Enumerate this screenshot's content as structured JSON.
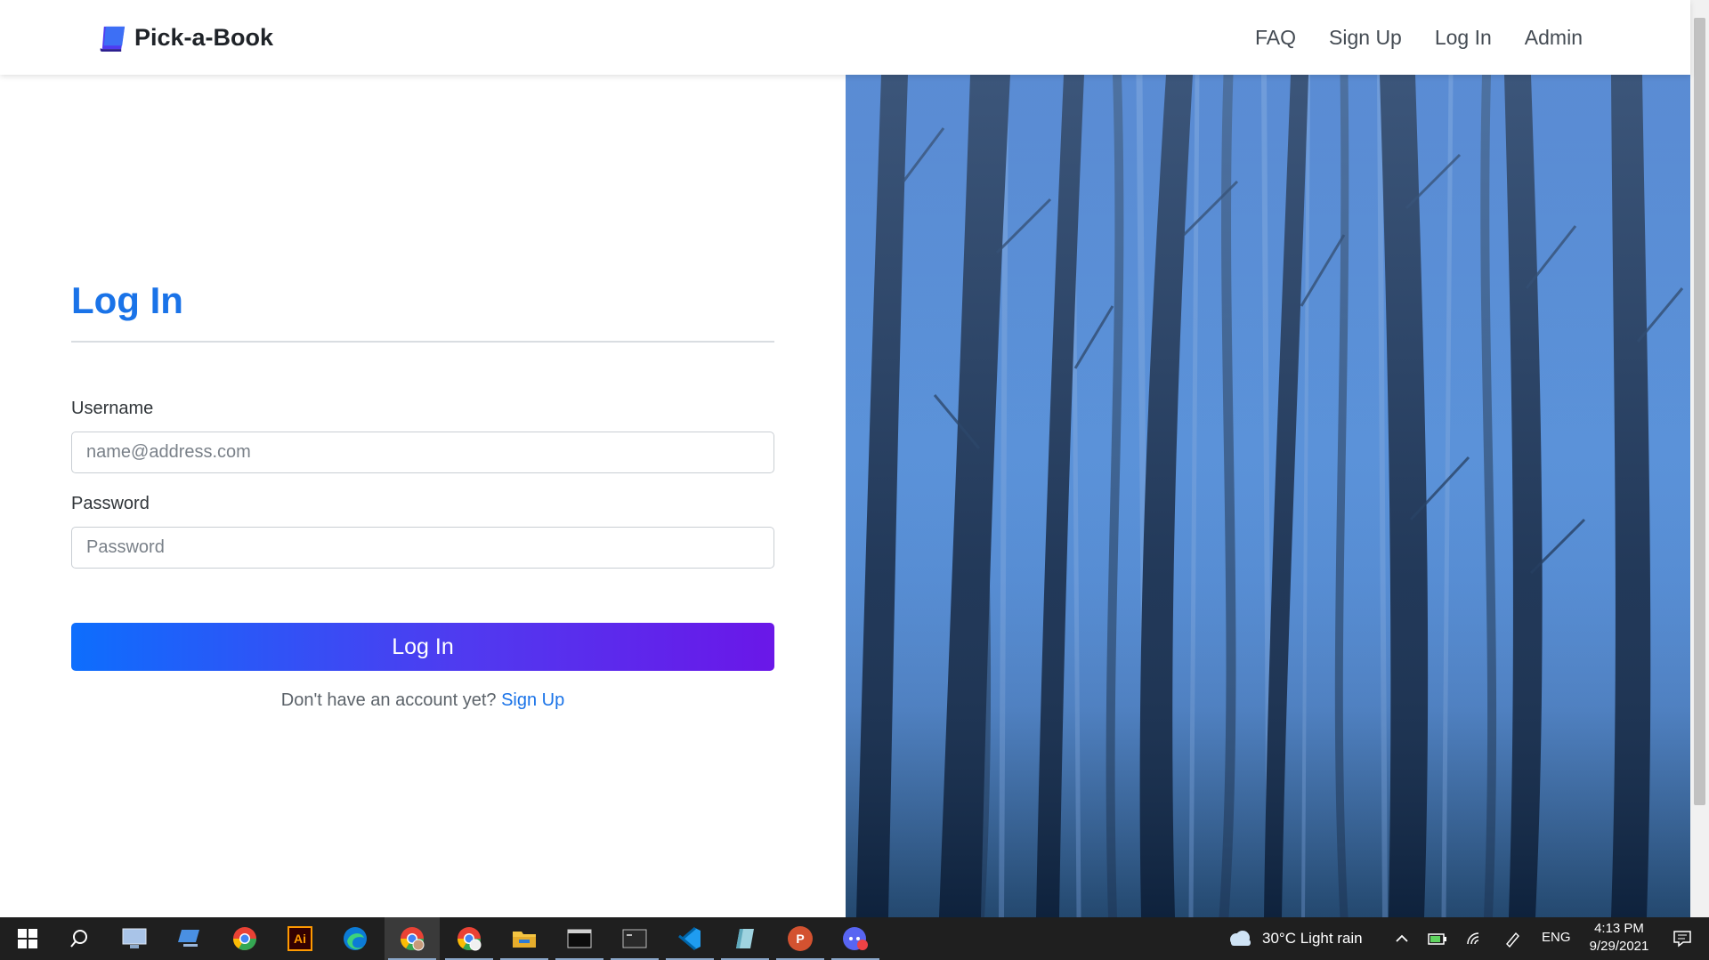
{
  "navbar": {
    "brand": "Pick-a-Book",
    "links": [
      "FAQ",
      "Sign Up",
      "Log In",
      "Admin"
    ]
  },
  "login": {
    "title": "Log In",
    "username_label": "Username",
    "username_placeholder": "name@address.com",
    "password_label": "Password",
    "password_placeholder": "Password",
    "submit_label": "Log In",
    "signup_prompt": "Don't have an account yet?",
    "signup_link": "Sign Up"
  },
  "colors": {
    "accent": "#1a73e8",
    "button_gradient_start": "#0d6efd",
    "button_gradient_end": "#6a17e8",
    "photo_tint": "#4e8ad6"
  },
  "taskbar": {
    "apps": [
      "windows-start-icon",
      "search-icon",
      "remote-desktop-icon",
      "monitor-icon",
      "chrome-icon",
      "illustrator-icon",
      "edge-icon",
      "chrome-profile-icon",
      "chrome-icon-2",
      "file-explorer-icon",
      "terminal-icon",
      "terminal-icon-2",
      "vscode-icon",
      "notes-icon",
      "powerpoint-icon",
      "discord-icon"
    ],
    "illustrator_label": "Ai",
    "powerpoint_label": "P",
    "weather": "30°C  Light rain",
    "language": "ENG",
    "time": "4:13 PM",
    "date": "9/29/2021"
  }
}
